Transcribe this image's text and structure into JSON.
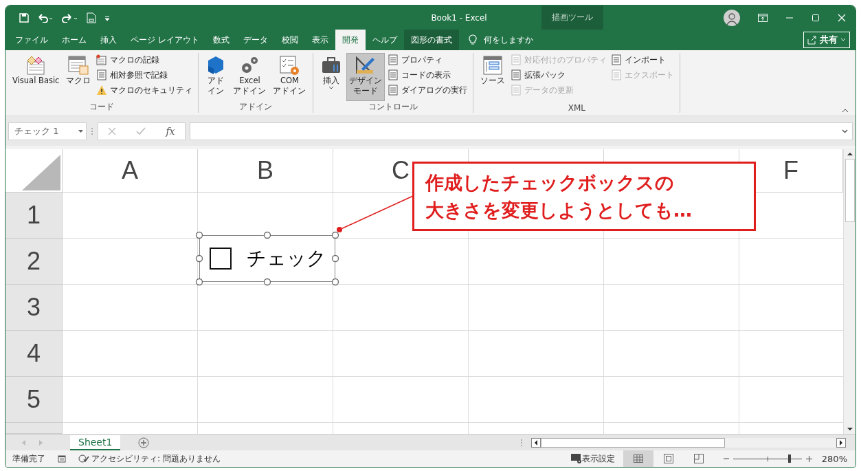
{
  "window": {
    "title": "Book1  -  Excel",
    "contextual_label": "描画ツール"
  },
  "tabs": [
    {
      "label": "ファイル",
      "selected": false,
      "kind": "normal"
    },
    {
      "label": "ホーム",
      "selected": false,
      "kind": "normal"
    },
    {
      "label": "挿入",
      "selected": false,
      "kind": "normal"
    },
    {
      "label": "ページ レイアウト",
      "selected": false,
      "kind": "normal"
    },
    {
      "label": "数式",
      "selected": false,
      "kind": "normal"
    },
    {
      "label": "データ",
      "selected": false,
      "kind": "normal"
    },
    {
      "label": "校閲",
      "selected": false,
      "kind": "normal"
    },
    {
      "label": "表示",
      "selected": false,
      "kind": "normal"
    },
    {
      "label": "開発",
      "selected": true,
      "kind": "normal"
    },
    {
      "label": "ヘルプ",
      "selected": false,
      "kind": "normal"
    },
    {
      "label": "図形の書式",
      "selected": false,
      "kind": "contextual"
    }
  ],
  "tell_me": {
    "placeholder": "何をしますか"
  },
  "share_button": {
    "label": "共有"
  },
  "ribbon": {
    "groups": [
      {
        "label": "コード",
        "large": [
          {
            "lines": [
              "Visual Basic"
            ],
            "pressed": false,
            "dropdown": false
          },
          {
            "lines": [
              "マクロ"
            ],
            "pressed": false,
            "dropdown": false
          }
        ],
        "small_columns": [
          [
            {
              "label": "マクロの記録",
              "disabled": false
            },
            {
              "label": "相対参照で記録",
              "disabled": false
            },
            {
              "label": "マクロのセキュリティ",
              "disabled": false
            }
          ]
        ]
      },
      {
        "label": "アドイン",
        "large": [
          {
            "lines": [
              "アド",
              "イン"
            ],
            "pressed": false,
            "dropdown": false
          },
          {
            "lines": [
              "Excel",
              "アドイン"
            ],
            "pressed": false,
            "dropdown": false
          },
          {
            "lines": [
              "COM",
              "アドイン"
            ],
            "pressed": false,
            "dropdown": false
          }
        ]
      },
      {
        "label": "コントロール",
        "large": [
          {
            "lines": [
              "挿入"
            ],
            "pressed": false,
            "dropdown": true
          },
          {
            "lines": [
              "デザイン",
              "モード"
            ],
            "pressed": true,
            "dropdown": false
          }
        ],
        "small_columns": [
          [
            {
              "label": "プロパティ",
              "disabled": false
            },
            {
              "label": "コードの表示",
              "disabled": false
            },
            {
              "label": "ダイアログの実行",
              "disabled": false
            }
          ]
        ]
      },
      {
        "label": "XML",
        "large": [
          {
            "lines": [
              "ソース"
            ],
            "pressed": false,
            "dropdown": false
          }
        ],
        "small_columns": [
          [
            {
              "label": "対応付けのプロパティ",
              "disabled": true
            },
            {
              "label": "拡張パック",
              "disabled": false
            },
            {
              "label": "データの更新",
              "disabled": true
            }
          ],
          [
            {
              "label": "インポート",
              "disabled": false
            },
            {
              "label": "エクスポート",
              "disabled": true
            }
          ]
        ]
      }
    ]
  },
  "name_box": {
    "value": "チェック 1"
  },
  "formula_bar": {
    "function_label": "fx"
  },
  "grid": {
    "columns": [
      {
        "label": "A"
      },
      {
        "label": "B"
      },
      {
        "label": "C"
      },
      null,
      null,
      {
        "label": "F"
      }
    ],
    "rows": [
      "1",
      "2",
      "3",
      "4",
      "5"
    ]
  },
  "checkbox_control": {
    "label": "チェック",
    "checked": false,
    "selected": true
  },
  "callout": {
    "lines": [
      "作成したチェックボックスの",
      "大きさを変更しようとしても…"
    ]
  },
  "sheet_tabs": [
    {
      "label": "Sheet1",
      "selected": true
    }
  ],
  "status_bar": {
    "ready": "準備完了",
    "accessibility": "アクセシビリティ: 問題ありません",
    "display_settings": "表示設定",
    "views": [
      {
        "kind": "normal",
        "selected": true
      },
      {
        "kind": "page_layout",
        "selected": false
      },
      {
        "kind": "page_break",
        "selected": false
      }
    ],
    "zoom": {
      "level": 0.82,
      "reading": "280%"
    }
  }
}
